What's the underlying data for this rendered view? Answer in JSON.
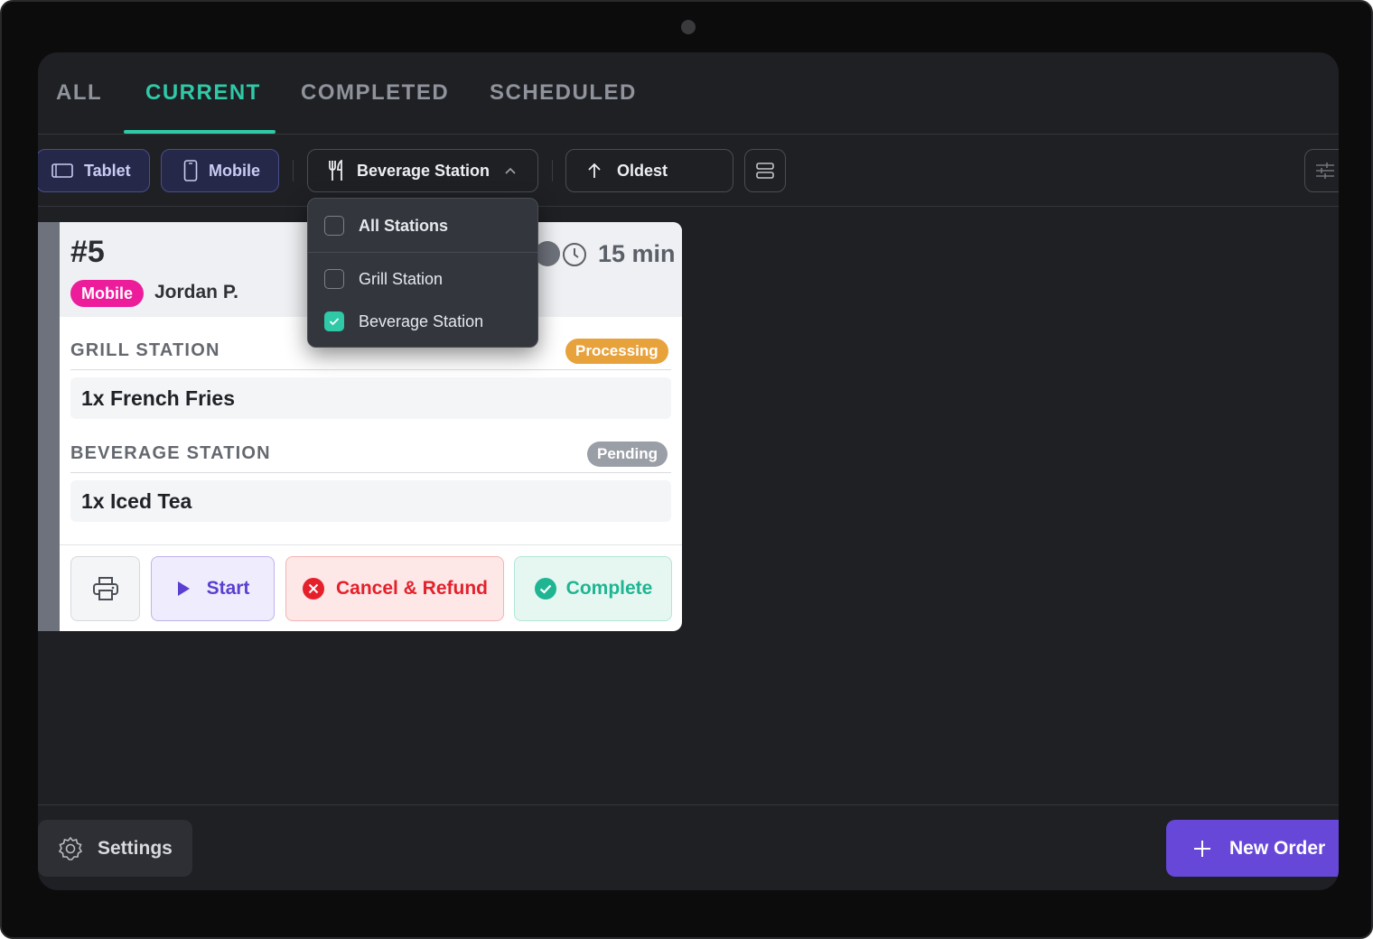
{
  "tabs": [
    {
      "label": "ALL",
      "active": false
    },
    {
      "label": "CURRENT",
      "active": true
    },
    {
      "label": "COMPLETED",
      "active": false
    },
    {
      "label": "SCHEDULED",
      "active": false
    }
  ],
  "toolbar": {
    "tablet_label": "Tablet",
    "mobile_label": "Mobile",
    "station_label": "Beverage Station",
    "sort_label": "Oldest"
  },
  "dropdown": {
    "items": [
      {
        "label": "All Stations",
        "checked": false
      },
      {
        "label": "Grill Station",
        "checked": false
      },
      {
        "label": "Beverage Station",
        "checked": true
      }
    ]
  },
  "order": {
    "number": "#5",
    "source": "Mobile",
    "customer": "Jordan P.",
    "elapsed": "15 min",
    "stations": [
      {
        "name": "GRILL STATION",
        "status": "Processing",
        "status_color": "#e8a23b",
        "items": [
          "1x French Fries"
        ]
      },
      {
        "name": "BEVERAGE STATION",
        "status": "Pending",
        "status_color": "#9a9ea6",
        "items": [
          "1x Iced Tea"
        ]
      }
    ],
    "actions": {
      "start": "Start",
      "cancel": "Cancel & Refund",
      "complete": "Complete"
    }
  },
  "footer": {
    "settings_label": "Settings",
    "new_order_label": "New Order"
  },
  "colors": {
    "accent": "#2fc9a7",
    "brand": "#6747d8",
    "mobile_badge": "#ec1c9b",
    "danger": "#e5202b"
  }
}
